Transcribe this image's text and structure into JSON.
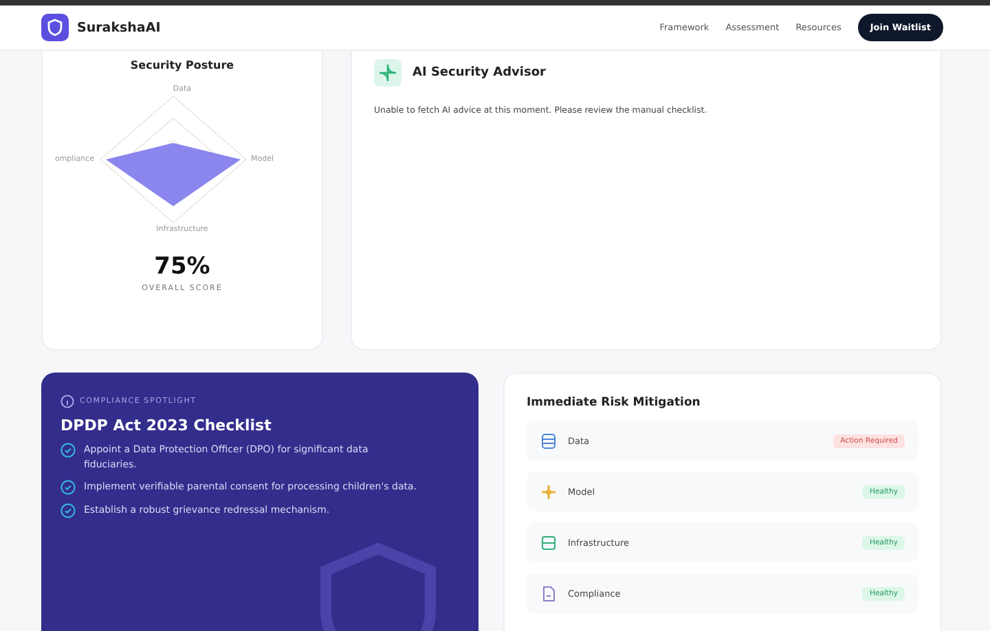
{
  "navbar": {
    "brand": "SurakshaAI",
    "links": [
      "Framework",
      "Assessment",
      "Resources"
    ],
    "cta": "Join Waitlist"
  },
  "posture": {
    "title": "Security Posture",
    "axes": {
      "top": "Data",
      "right": "Model",
      "bottom": "Infrastructure",
      "left": "ompliance"
    },
    "score": "75%",
    "score_label": "OVERALL SCORE"
  },
  "advisor": {
    "title": "AI Security Advisor",
    "message": "Unable to fetch AI advice at this moment. Please review the manual checklist."
  },
  "spotlight": {
    "eyebrow": "COMPLIANCE SPOTLIGHT",
    "title": "DPDP Act 2023 Checklist",
    "items": [
      "Appoint a Data Protection Officer (DPO) for significant data fiduciaries.",
      "Implement verifiable parental consent for processing children's data.",
      "Establish a robust grievance redressal mechanism."
    ]
  },
  "risk": {
    "title": "Immediate Risk Mitigation",
    "rows": [
      {
        "kind": "database",
        "name": "Data",
        "alert": true,
        "badge": "Action Required"
      },
      {
        "kind": "cpu",
        "name": "Model",
        "alert": false,
        "badge": "Healthy"
      },
      {
        "kind": "server",
        "name": "Infrastructure",
        "alert": false,
        "badge": "Healthy"
      },
      {
        "kind": "file",
        "name": "Compliance",
        "alert": false,
        "badge": "Healthy"
      }
    ]
  }
}
